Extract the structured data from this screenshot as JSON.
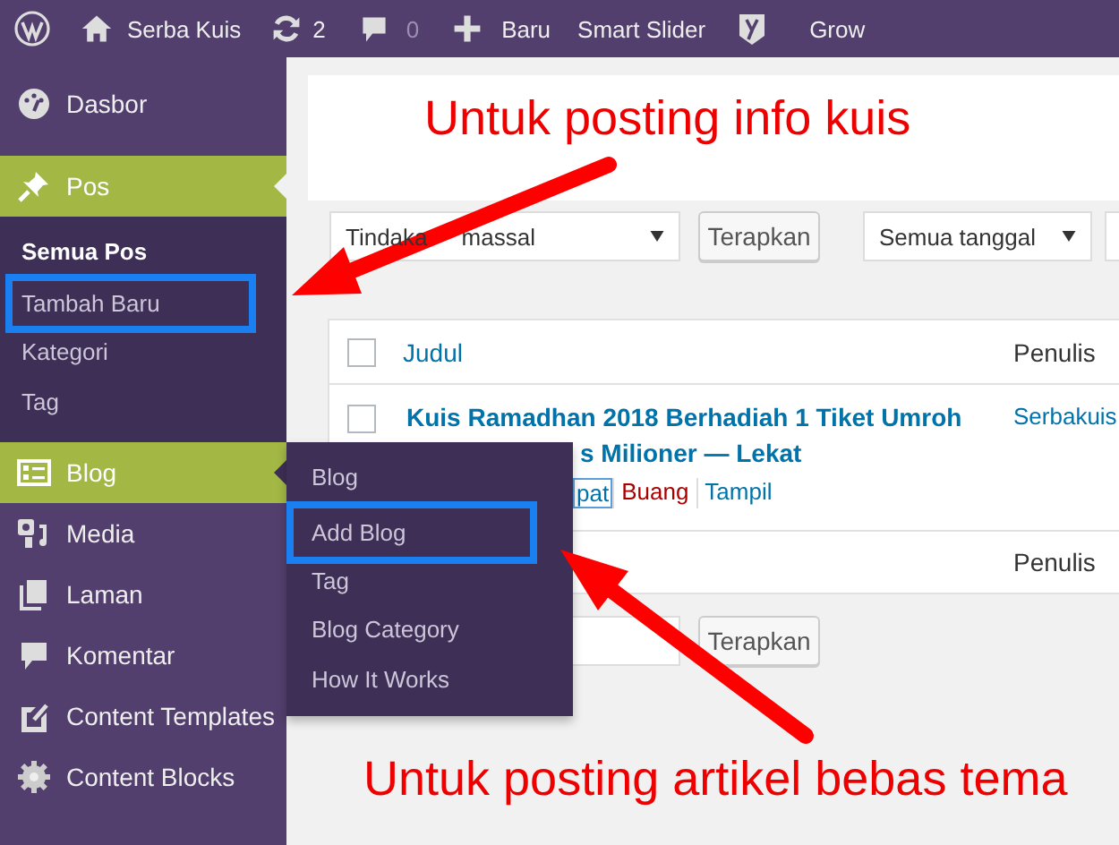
{
  "admin_bar": {
    "items": [
      {
        "kind": "logo"
      },
      {
        "kind": "site",
        "label": "Serba Kuis"
      },
      {
        "kind": "updates",
        "label": "2"
      },
      {
        "kind": "comments",
        "label": "0"
      },
      {
        "kind": "new",
        "label": "Baru"
      },
      {
        "kind": "link",
        "label": "Smart Slider"
      },
      {
        "kind": "seo"
      },
      {
        "kind": "link",
        "label": "Grow"
      }
    ]
  },
  "sidebar": {
    "items": [
      {
        "label": "Dasbor",
        "highlighted": false
      },
      {
        "label": "Pos",
        "highlighted": true,
        "submenu": [
          {
            "label": "Semua Pos",
            "selected": true,
            "framed": false
          },
          {
            "label": "Tambah Baru",
            "selected": false,
            "framed": true
          },
          {
            "label": "Kategori",
            "selected": false,
            "framed": false
          },
          {
            "label": "Tag",
            "selected": false,
            "framed": false
          }
        ]
      },
      {
        "label": "Blog",
        "highlighted": true
      },
      {
        "label": "Media",
        "highlighted": false
      },
      {
        "label": "Laman",
        "highlighted": false
      },
      {
        "label": "Komentar",
        "highlighted": false
      },
      {
        "label": "Content Templates",
        "highlighted": false
      },
      {
        "label": "Content Blocks",
        "highlighted": false
      }
    ]
  },
  "flyout_menu": {
    "items": [
      {
        "label": "Blog",
        "framed": false
      },
      {
        "label": "Add Blog",
        "framed": true
      },
      {
        "label": "Tag",
        "framed": false
      },
      {
        "label": "Blog Category",
        "framed": false
      },
      {
        "label": "How It Works",
        "framed": false
      }
    ]
  },
  "toolbar": {
    "bulk_action_start": "Tindaka",
    "bulk_action_end": "massal",
    "apply": "Terapkan",
    "date_filter": "Semua tanggal"
  },
  "table": {
    "columns": [
      "Judul",
      "Penulis"
    ],
    "header_checked": false,
    "rows": [
      {
        "checked": false,
        "title": "Kuis Ramadhan 2018 Berhadiah 1 Tiket Umroh",
        "title_rest": "s Milioner — Lekat",
        "actions": [
          {
            "label": "pat",
            "kind": "edit"
          },
          {
            "label": "Buang",
            "kind": "trash"
          },
          {
            "label": "Tampil",
            "kind": "view"
          }
        ],
        "author": "Serbakuis"
      }
    ],
    "footer_columns": [
      "Penulis"
    ]
  },
  "bottom_toolbar": {
    "apply": "Terapkan"
  },
  "annotations": [
    "Untuk posting info kuis",
    "Untuk posting artikel bebas tema"
  ]
}
